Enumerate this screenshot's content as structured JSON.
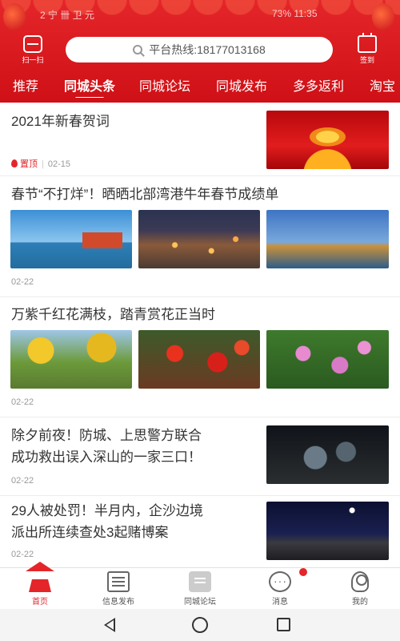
{
  "status_bar": {
    "left_text": "2 宁 卌 卫 元",
    "right_text": "73% 11:35"
  },
  "header": {
    "scan_label": "扫一扫",
    "search_placeholder": "平台热线:18177013168",
    "checkin_label": "签到"
  },
  "tabs": [
    {
      "label": "推荐",
      "active": false
    },
    {
      "label": "同城头条",
      "active": true
    },
    {
      "label": "同城论坛",
      "active": false
    },
    {
      "label": "同城发布",
      "active": false
    },
    {
      "label": "多多返利",
      "active": false
    },
    {
      "label": "淘宝",
      "active": false
    }
  ],
  "articles": [
    {
      "title": "2021年新春贺词",
      "tag": "置顶",
      "date": "02-15",
      "images": [
        "spring-festival-stage"
      ]
    },
    {
      "title": "春节“不打烊”！晒晒北部湾港牛年春节成绩单",
      "date": "02-22",
      "images": [
        "port-day",
        "port-night",
        "port-crane"
      ]
    },
    {
      "title": "万紫千红花满枝，踏青赏花正当时",
      "date": "02-22",
      "images": [
        "yellow-trees",
        "red-flowers",
        "pink-flowers"
      ]
    },
    {
      "title_line1": "除夕前夜！防城、上思警方联合",
      "title_line2": "成功救出误入深山的一家三口！",
      "date": "02-22",
      "images": [
        "night-rescue"
      ]
    },
    {
      "title_line1": "29人被处罚！半月内，企沙边境",
      "title_line2": "派出所连续查处3起赌博案",
      "date": "02-22",
      "images": [
        "night-police"
      ]
    }
  ],
  "bottom_nav": [
    {
      "label": "首页",
      "icon": "home-icon",
      "active": true
    },
    {
      "label": "信息发布",
      "icon": "news-icon",
      "active": false
    },
    {
      "label": "同城论坛",
      "icon": "forum-icon",
      "active": false
    },
    {
      "label": "消息",
      "icon": "message-icon",
      "active": false,
      "badge": true
    },
    {
      "label": "我的",
      "icon": "profile-icon",
      "active": false
    }
  ],
  "colors": {
    "brand_red": "#d9161b",
    "accent": "#e4262a"
  }
}
